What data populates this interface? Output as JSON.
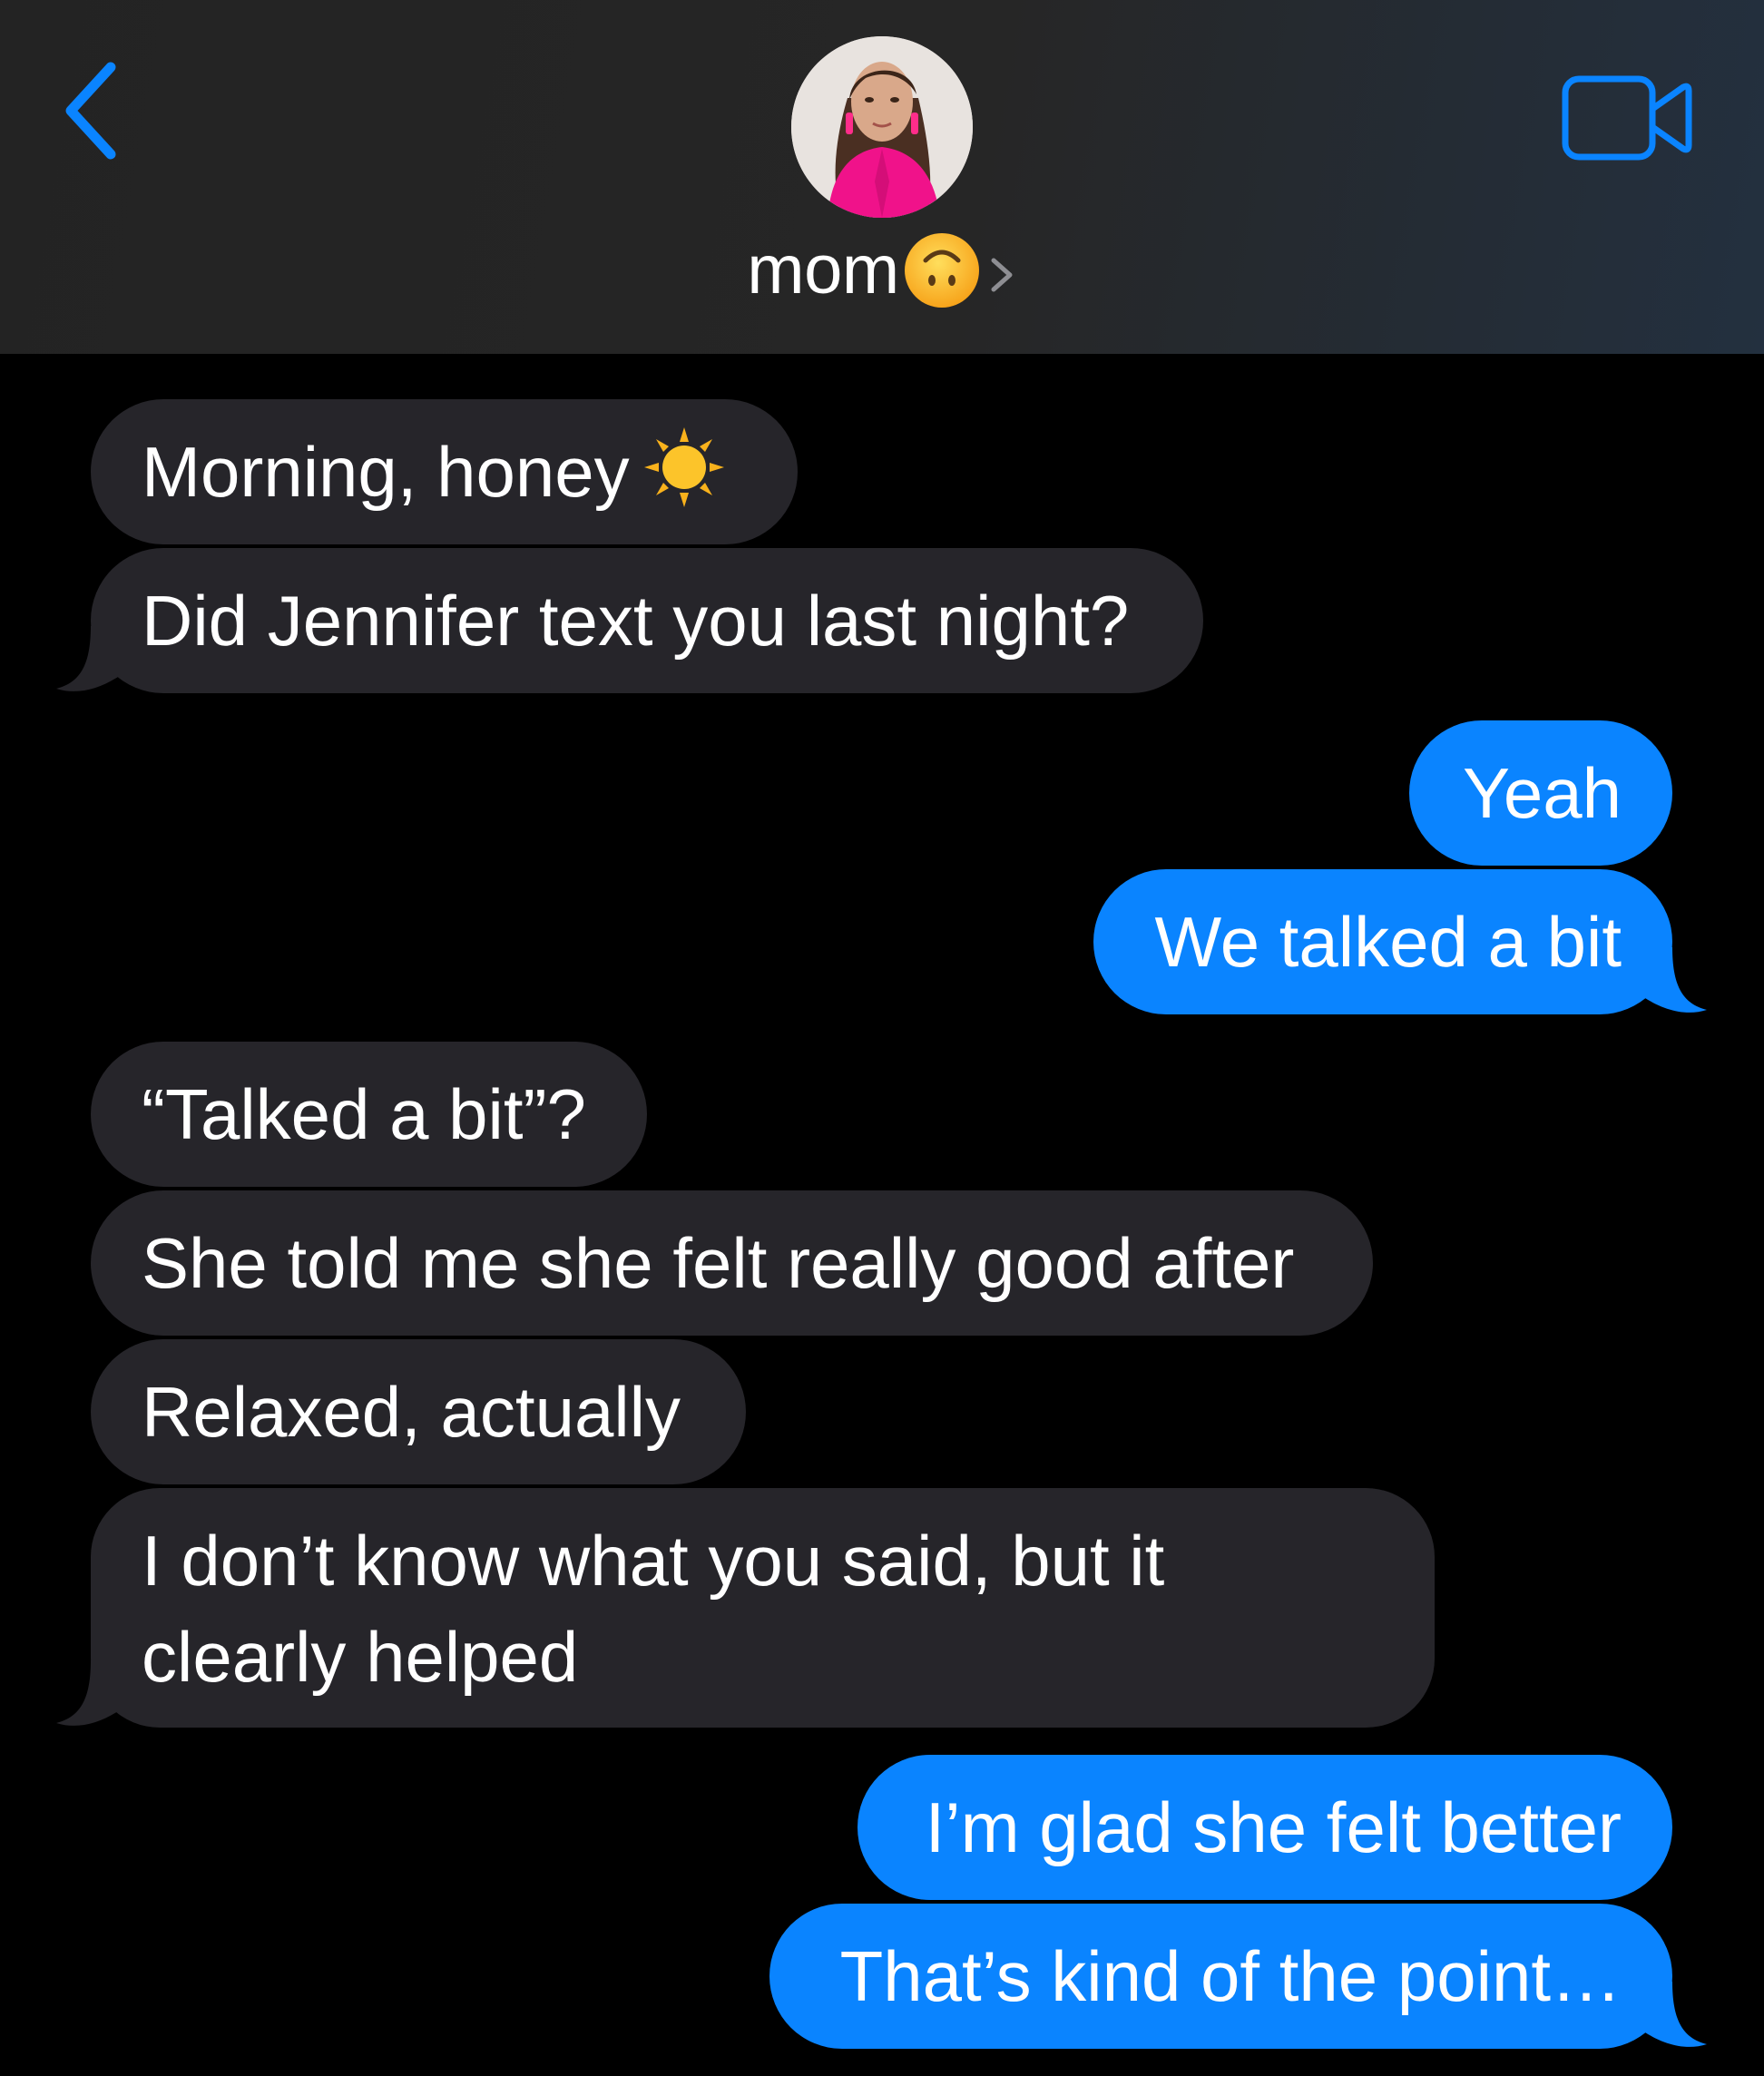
{
  "header": {
    "back_icon": "chevron-left-icon",
    "contact_name": "mom",
    "contact_emoji": "upside-down-face-emoji",
    "contact_chevron_icon": "chevron-right-icon",
    "video_icon": "video-camera-icon",
    "accent_color": "#0a84ff"
  },
  "messages": [
    {
      "direction": "incoming",
      "text": "Morning, honey",
      "emoji": "sun-emoji"
    },
    {
      "direction": "incoming",
      "text": "Did Jennifer text you last night?"
    },
    {
      "direction": "outgoing",
      "text": "Yeah"
    },
    {
      "direction": "outgoing",
      "text": "We talked a bit"
    },
    {
      "direction": "incoming",
      "text": "“Talked a bit”?"
    },
    {
      "direction": "incoming",
      "text": "She told me she felt really good after"
    },
    {
      "direction": "incoming",
      "text": "Relaxed, actually"
    },
    {
      "direction": "incoming",
      "text": "I don’t know what you said, but it clearly helped",
      "lines": [
        "I don’t know what you said, but it",
        "clearly helped"
      ]
    },
    {
      "direction": "outgoing",
      "text": "I’m glad she felt better"
    },
    {
      "direction": "outgoing",
      "text": "That’s kind of the point…"
    }
  ],
  "colors": {
    "incoming_bubble": "#26252a",
    "outgoing_bubble": "#0a84ff",
    "background": "#000000"
  }
}
